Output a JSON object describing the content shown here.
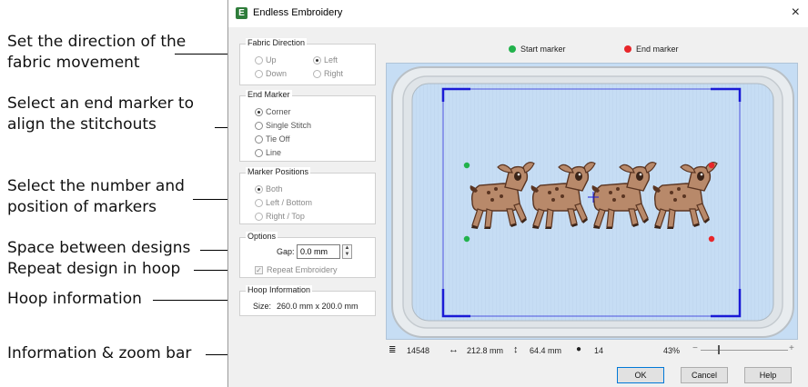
{
  "annotations": [
    {
      "line1": "Set the direction of the",
      "line2": "fabric movement"
    },
    {
      "line1": "Select an end marker to",
      "line2": "align the stitchouts"
    },
    {
      "line1": "Select the number and",
      "line2": "position of markers"
    },
    {
      "line1": "Space between designs"
    },
    {
      "line1": "Repeat design in hoop"
    },
    {
      "line1": "Hoop information"
    },
    {
      "line1": "Information & zoom bar"
    }
  ],
  "dialog": {
    "title": "Endless Embroidery",
    "app_icon_glyph": "E",
    "close_glyph": "×"
  },
  "fabric_direction": {
    "title": "Fabric Direction",
    "options": [
      {
        "label": "Up",
        "selected": false
      },
      {
        "label": "Left",
        "selected": true
      },
      {
        "label": "Down",
        "selected": false
      },
      {
        "label": "Right",
        "selected": false
      }
    ]
  },
  "end_marker": {
    "title": "End Marker",
    "options": [
      {
        "label": "Corner",
        "selected": true
      },
      {
        "label": "Single Stitch",
        "selected": false
      },
      {
        "label": "Tie Off",
        "selected": false
      },
      {
        "label": "Line",
        "selected": false
      }
    ]
  },
  "marker_positions": {
    "title": "Marker Positions",
    "options": [
      {
        "label": "Both",
        "selected": true
      },
      {
        "label": "Left / Bottom",
        "selected": false
      },
      {
        "label": "Right / Top",
        "selected": false
      }
    ]
  },
  "options": {
    "title": "Options",
    "gap_label": "Gap:",
    "gap_value": "0.0 mm",
    "repeat_label": "Repeat Embroidery",
    "repeat_checked": true
  },
  "hoop_info": {
    "title": "Hoop Information",
    "size_label": "Size:",
    "size_value": "260.0 mm x 200.0 mm"
  },
  "legend": {
    "start": {
      "label": "Start marker",
      "color": "#22b24c"
    },
    "end": {
      "label": "End marker",
      "color": "#e8262a"
    }
  },
  "status_bar": {
    "stitches": "14548",
    "width": "212.8 mm",
    "height": "64.4 mm",
    "colors": "14",
    "zoom": "43%",
    "zoom_minus": "−",
    "zoom_plus": "+",
    "zoom_level": 0.2
  },
  "buttons": {
    "ok": "OK",
    "cancel": "Cancel",
    "help": "Help"
  },
  "colors": {
    "hoop_line": "#1b1bd6",
    "preview_bg": "#c6ddf4",
    "deer_body": "#b8896a",
    "deer_dark": "#5a3522"
  }
}
